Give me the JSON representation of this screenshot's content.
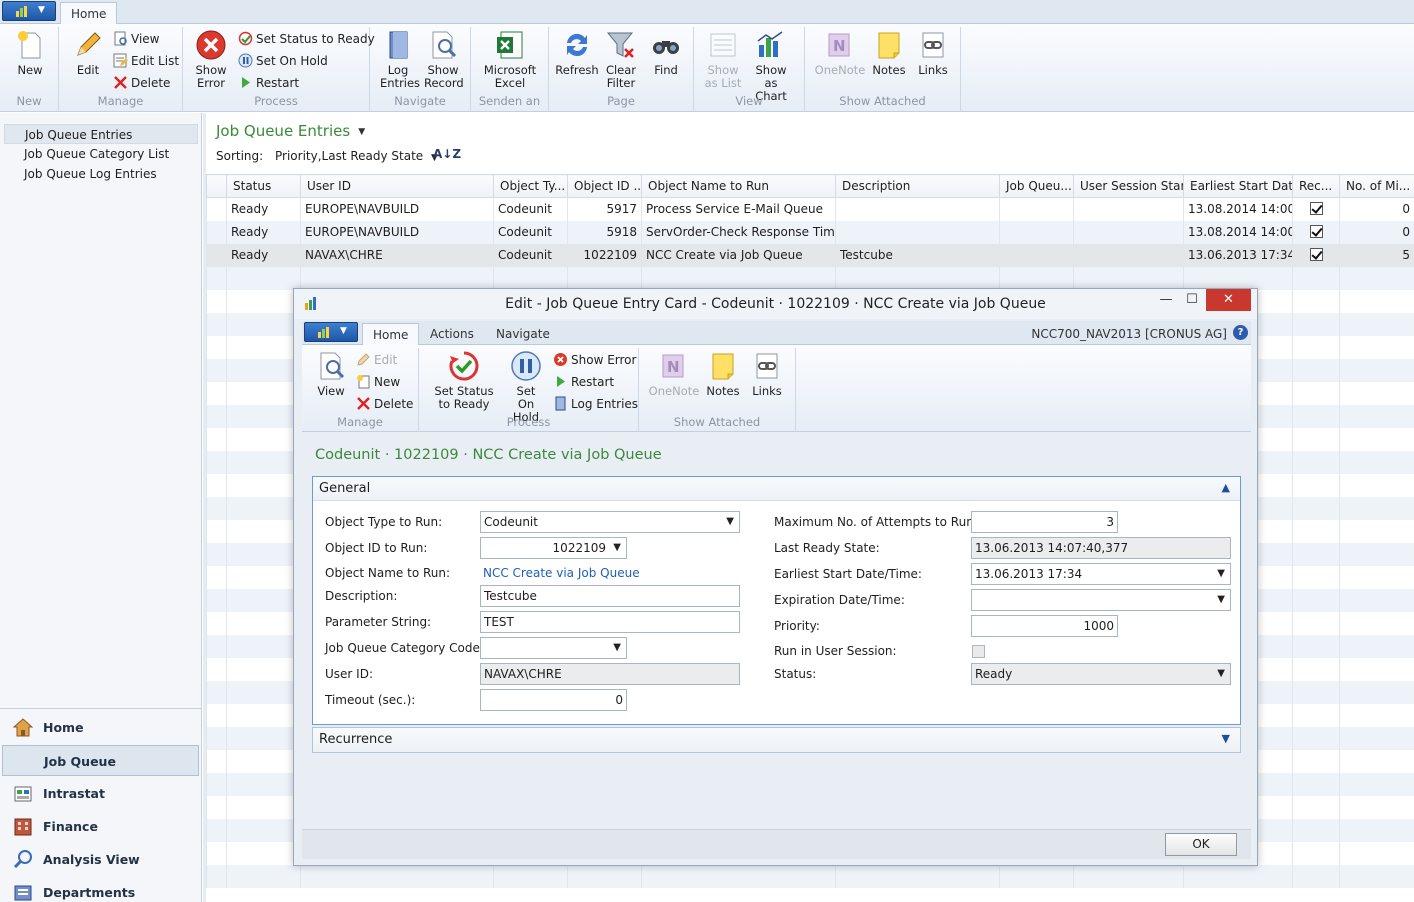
{
  "main_tabs": [
    {
      "label": "Home"
    }
  ],
  "ribbon": {
    "groups": [
      {
        "label": "New"
      },
      {
        "label": "Manage"
      },
      {
        "label": "Process"
      },
      {
        "label": "Navigate"
      },
      {
        "label": "Senden an"
      },
      {
        "label": "Page"
      },
      {
        "label": "View"
      },
      {
        "label": "Show Attached"
      }
    ],
    "new": "New",
    "edit": "Edit",
    "view": "View",
    "edit_list": "Edit List",
    "delete": "Delete",
    "show_error": "Show Error",
    "set_status_ready": "Set Status to Ready",
    "set_on_hold": "Set On Hold",
    "restart": "Restart",
    "log_entries": "Log Entries",
    "show_record": "Show Record",
    "microsoft_excel": "Microsoft Excel",
    "refresh": "Refresh",
    "clear_filter": "Clear Filter",
    "find": "Find",
    "show_as_list": "Show as List",
    "show_as_chart": "Show as Chart",
    "onenote": "OneNote",
    "notes": "Notes",
    "links": "Links"
  },
  "leftnav": {
    "links": [
      {
        "label": "Job Queue Entries"
      },
      {
        "label": "Job Queue Category List"
      },
      {
        "label": "Job Queue Log Entries"
      }
    ],
    "buttons": [
      {
        "label": "Home",
        "icon": "house-icon"
      },
      {
        "label": "Job Queue",
        "icon": "none"
      },
      {
        "label": "Intrastat",
        "icon": "intrastat-icon"
      },
      {
        "label": "Finance",
        "icon": "finance-icon"
      },
      {
        "label": "Analysis View",
        "icon": "analysis-icon"
      },
      {
        "label": "Departments",
        "icon": "departments-icon"
      }
    ]
  },
  "page": {
    "title": "Job Queue Entries",
    "sorting_label": "Sorting:",
    "sorting_value": "Priority,Last Ready State",
    "sort_icon": "A↓Z"
  },
  "grid": {
    "columns": [
      "Status",
      "User ID",
      "Object Ty...",
      "Object ID ...",
      "Object Name to Run",
      "Description",
      "Job Queu...",
      "User Session Star...",
      "Earliest Start Dat...",
      "Rec...",
      "No. of Mi..."
    ],
    "rows": [
      {
        "status": "Ready",
        "user": "EUROPE\\NAVBUILD",
        "type": "Codeunit",
        "id": "5917",
        "name": "Process Service E-Mail Queue",
        "desc": "",
        "cat": "",
        "session": "",
        "start": "13.08.2014 14:00",
        "recurring": true,
        "minutes": "0"
      },
      {
        "status": "Ready",
        "user": "EUROPE\\NAVBUILD",
        "type": "Codeunit",
        "id": "5918",
        "name": "ServOrder-Check Response Time",
        "desc": "",
        "cat": "",
        "session": "",
        "start": "13.08.2014 14:00",
        "recurring": true,
        "minutes": "0"
      },
      {
        "status": "Ready",
        "user": "NAVAX\\CHRE",
        "type": "Codeunit",
        "id": "1022109",
        "name": "NCC Create via Job Queue",
        "desc": "Testcube",
        "cat": "",
        "session": "",
        "start": "13.06.2013 17:34",
        "recurring": true,
        "minutes": "5"
      }
    ]
  },
  "dialog": {
    "title": "Edit - Job Queue Entry Card - Codeunit · 1022109 · NCC Create via Job Queue",
    "minimize": "—",
    "maximize": "☐",
    "close": "✕",
    "tabs": [
      "Home",
      "Actions",
      "Navigate"
    ],
    "company": "NCC700_NAV2013 [CRONUS AG]",
    "help": "?",
    "ribbon": {
      "view": "View",
      "edit": "Edit",
      "new": "New",
      "delete": "Delete",
      "set_status_ready": "Set Status to Ready",
      "set_on_hold": "Set On Hold",
      "show_error": "Show Error",
      "restart": "Restart",
      "log_entries": "Log Entries",
      "onenote": "OneNote",
      "notes": "Notes",
      "links": "Links",
      "group_manage": "Manage",
      "group_process": "Process",
      "group_show_attached": "Show Attached"
    },
    "card_title": "Codeunit · 1022109 · NCC Create via Job Queue",
    "general_label": "General",
    "recurrence_label": "Recurrence",
    "fields": {
      "object_type_label": "Object Type to Run:",
      "object_type": "Codeunit",
      "object_id_label": "Object ID to Run:",
      "object_id": "1022109",
      "object_name_label": "Object Name to Run:",
      "object_name": "NCC Create via Job Queue",
      "description_label": "Description:",
      "description": "Testcube",
      "parameter_label": "Parameter String:",
      "parameter": "TEST",
      "category_label": "Job Queue Category Code:",
      "category": "",
      "user_id_label": "User ID:",
      "user_id": "NAVAX\\CHRE",
      "timeout_label": "Timeout (sec.):",
      "timeout": "0",
      "max_attempts_label": "Maximum No. of Attempts to Run:",
      "max_attempts": "3",
      "last_ready_label": "Last Ready State:",
      "last_ready": "13.06.2013 14:07:40,377",
      "earliest_start_label": "Earliest Start Date/Time:",
      "earliest_start": "13.06.2013 17:34",
      "expiration_label": "Expiration Date/Time:",
      "expiration": "",
      "priority_label": "Priority:",
      "priority": "1000",
      "run_in_session_label": "Run in User Session:",
      "status_label": "Status:",
      "status": "Ready"
    },
    "ok": "OK"
  }
}
